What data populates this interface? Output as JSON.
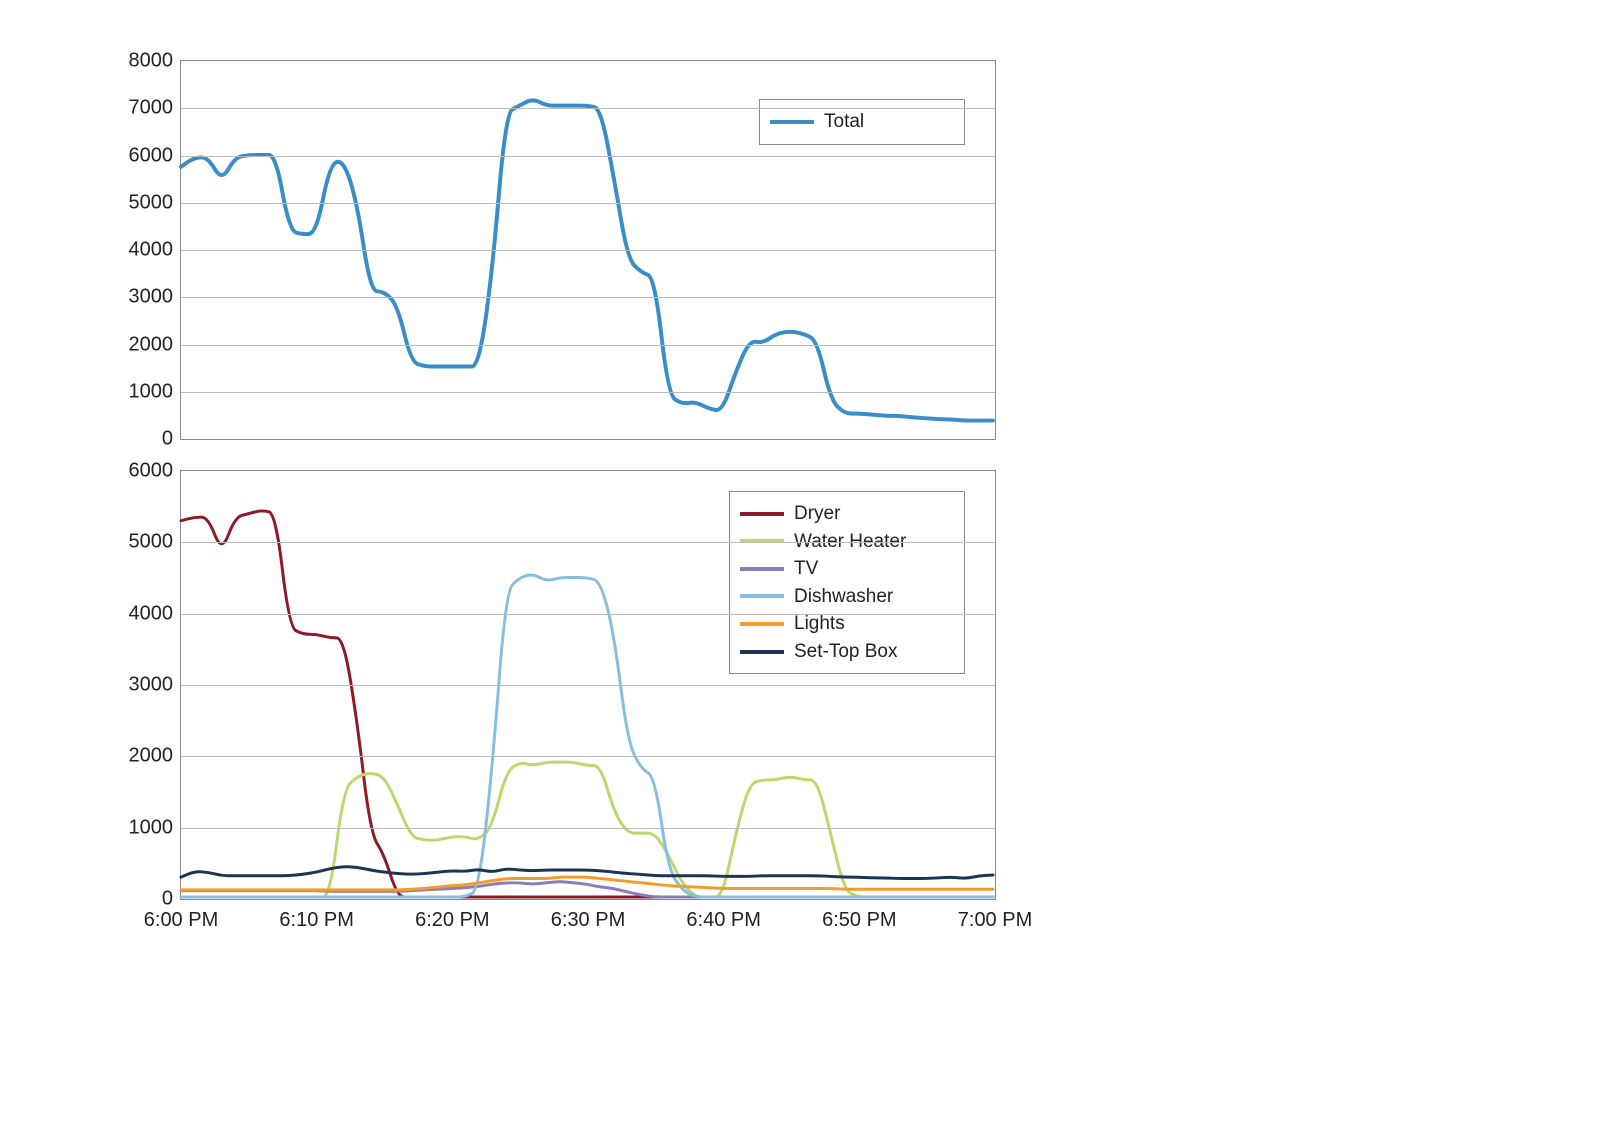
{
  "x_labels": [
    "6:00 PM",
    "6:10 PM",
    "6:20 PM",
    "6:30 PM",
    "6:40 PM",
    "6:50 PM",
    "7:00 PM"
  ],
  "x_range_minutes": [
    0,
    60
  ],
  "chart_top": {
    "ylim": [
      0,
      8000
    ],
    "yticks": [
      0,
      1000,
      2000,
      3000,
      4000,
      5000,
      6000,
      7000,
      8000
    ],
    "legend": [
      {
        "name": "Total",
        "color": "#3a8ec7"
      }
    ]
  },
  "chart_bottom": {
    "ylim": [
      0,
      6000
    ],
    "yticks": [
      0,
      1000,
      2000,
      3000,
      4000,
      5000,
      6000
    ],
    "legend": [
      {
        "name": "Dryer",
        "color": "#8b1a2a"
      },
      {
        "name": "Water Heater",
        "color": "#b9d96a"
      },
      {
        "name": "TV",
        "color": "#8a7eb8"
      },
      {
        "name": "Dishwasher",
        "color": "#87bde0"
      },
      {
        "name": "Lights",
        "color": "#f39c2c"
      },
      {
        "name": "Set-Top Box",
        "color": "#1c3552"
      }
    ]
  },
  "chart_data": [
    {
      "type": "line",
      "title": "",
      "xlabel": "",
      "ylabel": "",
      "x_unit": "minutes after 6:00 PM",
      "ylim": [
        0,
        8000
      ],
      "x_tick_labels": [
        "6:00 PM",
        "6:10 PM",
        "6:20 PM",
        "6:30 PM",
        "6:40 PM",
        "6:50 PM",
        "7:00 PM"
      ],
      "series": [
        {
          "name": "Total",
          "color": "#3a8ec7",
          "stroke_width": 4,
          "x": [
            0,
            1,
            2,
            3,
            4,
            5,
            6,
            7,
            8,
            9,
            10,
            11,
            12,
            13,
            14,
            15,
            16,
            17,
            18,
            19,
            20,
            21,
            22,
            23,
            24,
            25,
            26,
            27,
            28,
            29,
            30,
            31,
            32,
            33,
            34,
            35,
            36,
            37,
            38,
            39,
            40,
            41,
            42,
            43,
            44,
            45,
            46,
            47,
            48,
            49,
            50,
            51,
            52,
            53,
            54,
            55,
            56,
            57,
            58,
            59,
            60
          ],
          "values": [
            5750,
            5950,
            5950,
            5450,
            5950,
            6000,
            6000,
            6000,
            4400,
            4300,
            4350,
            5800,
            5900,
            5000,
            3100,
            3100,
            2800,
            1600,
            1500,
            1500,
            1500,
            1500,
            1500,
            3500,
            6900,
            7050,
            7200,
            7050,
            7050,
            7050,
            7050,
            7000,
            5500,
            3800,
            3500,
            3400,
            900,
            700,
            750,
            600,
            550,
            1400,
            2050,
            2000,
            2200,
            2250,
            2200,
            2050,
            800,
            500,
            500,
            480,
            450,
            450,
            420,
            400,
            380,
            370,
            350,
            350,
            350
          ]
        }
      ]
    },
    {
      "type": "line",
      "title": "",
      "xlabel": "",
      "ylabel": "",
      "x_unit": "minutes after 6:00 PM",
      "ylim": [
        0,
        6000
      ],
      "x_tick_labels": [
        "6:00 PM",
        "6:10 PM",
        "6:20 PM",
        "6:30 PM",
        "6:40 PM",
        "6:50 PM",
        "7:00 PM"
      ],
      "series": [
        {
          "name": "Dryer",
          "color": "#8b1a2a",
          "stroke_width": 3,
          "x": [
            0,
            1,
            2,
            3,
            4,
            5,
            6,
            7,
            8,
            9,
            10,
            11,
            12,
            13,
            14,
            15,
            16,
            17,
            18,
            19,
            20,
            21,
            22,
            23,
            24,
            25,
            26,
            27,
            28,
            29,
            30,
            31,
            32,
            33,
            34,
            35,
            36,
            37,
            38,
            39,
            40,
            41,
            42,
            43,
            44,
            45,
            46,
            47,
            48,
            49,
            50,
            51,
            52,
            53,
            54,
            55,
            56,
            57,
            58,
            59,
            60
          ],
          "values": [
            5300,
            5350,
            5350,
            4850,
            5350,
            5400,
            5450,
            5400,
            3800,
            3700,
            3700,
            3650,
            3650,
            2500,
            900,
            600,
            0,
            0,
            0,
            0,
            0,
            0,
            0,
            0,
            0,
            0,
            0,
            0,
            0,
            0,
            0,
            0,
            0,
            0,
            0,
            0,
            0,
            0,
            0,
            0,
            0,
            0,
            0,
            0,
            0,
            0,
            0,
            0,
            0,
            0,
            0,
            0,
            0,
            0,
            0,
            0,
            0,
            0,
            0,
            0,
            0
          ]
        },
        {
          "name": "Water Heater",
          "color": "#b9d96a",
          "stroke_width": 3,
          "x": [
            0,
            1,
            2,
            3,
            4,
            5,
            6,
            7,
            8,
            9,
            10,
            11,
            12,
            13,
            14,
            15,
            16,
            17,
            18,
            19,
            20,
            21,
            22,
            23,
            24,
            25,
            26,
            27,
            28,
            29,
            30,
            31,
            32,
            33,
            34,
            35,
            36,
            37,
            38,
            39,
            40,
            41,
            42,
            43,
            44,
            45,
            46,
            47,
            48,
            49,
            50,
            51,
            52,
            53,
            54,
            55,
            56,
            57,
            58,
            59,
            60
          ],
          "values": [
            0,
            0,
            0,
            0,
            0,
            0,
            0,
            0,
            0,
            0,
            0,
            0,
            1500,
            1700,
            1750,
            1700,
            1300,
            850,
            800,
            800,
            850,
            850,
            800,
            1000,
            1750,
            1900,
            1850,
            1900,
            1900,
            1900,
            1850,
            1850,
            1200,
            900,
            900,
            900,
            600,
            200,
            0,
            0,
            0,
            900,
            1600,
            1650,
            1650,
            1700,
            1650,
            1650,
            900,
            100,
            0,
            0,
            0,
            0,
            0,
            0,
            0,
            0,
            0,
            0,
            0
          ]
        },
        {
          "name": "TV",
          "color": "#8a7eb8",
          "stroke_width": 3,
          "x": [
            0,
            1,
            2,
            3,
            4,
            5,
            6,
            7,
            8,
            9,
            10,
            11,
            12,
            13,
            14,
            15,
            16,
            17,
            18,
            19,
            20,
            21,
            22,
            23,
            24,
            25,
            26,
            27,
            28,
            29,
            30,
            31,
            32,
            33,
            34,
            35,
            36,
            37,
            38,
            39,
            40,
            41,
            42,
            43,
            44,
            45,
            46,
            47,
            48,
            49,
            50,
            51,
            52,
            53,
            54,
            55,
            56,
            57,
            58,
            59,
            60
          ],
          "values": [
            90,
            90,
            90,
            90,
            90,
            90,
            90,
            90,
            90,
            90,
            90,
            80,
            80,
            80,
            80,
            80,
            80,
            90,
            100,
            110,
            120,
            130,
            150,
            180,
            200,
            200,
            180,
            200,
            220,
            200,
            180,
            140,
            120,
            70,
            30,
            0,
            0,
            0,
            0,
            0,
            0,
            0,
            0,
            0,
            0,
            0,
            0,
            0,
            0,
            0,
            0,
            0,
            0,
            0,
            0,
            0,
            0,
            0,
            0,
            0,
            0
          ]
        },
        {
          "name": "Dishwasher",
          "color": "#87bde0",
          "stroke_width": 3,
          "x": [
            0,
            1,
            2,
            3,
            4,
            5,
            6,
            7,
            8,
            9,
            10,
            11,
            12,
            13,
            14,
            15,
            16,
            17,
            18,
            19,
            20,
            21,
            22,
            23,
            24,
            25,
            26,
            27,
            28,
            29,
            30,
            31,
            32,
            33,
            34,
            35,
            36,
            37,
            38,
            39,
            40,
            41,
            42,
            43,
            44,
            45,
            46,
            47,
            48,
            49,
            50,
            51,
            52,
            53,
            54,
            55,
            56,
            57,
            58,
            59,
            60
          ],
          "values": [
            0,
            0,
            0,
            0,
            0,
            0,
            0,
            0,
            0,
            0,
            0,
            0,
            0,
            0,
            0,
            0,
            0,
            0,
            0,
            0,
            0,
            0,
            100,
            1800,
            4300,
            4500,
            4550,
            4450,
            4500,
            4500,
            4500,
            4450,
            3700,
            2200,
            1800,
            1700,
            400,
            100,
            0,
            0,
            0,
            0,
            0,
            0,
            0,
            0,
            0,
            0,
            0,
            0,
            0,
            0,
            0,
            0,
            0,
            0,
            0,
            0,
            0,
            0,
            0
          ]
        },
        {
          "name": "Lights",
          "color": "#f39c2c",
          "stroke_width": 3,
          "x": [
            0,
            1,
            2,
            3,
            4,
            5,
            6,
            7,
            8,
            9,
            10,
            11,
            12,
            13,
            14,
            15,
            16,
            17,
            18,
            19,
            20,
            21,
            22,
            23,
            24,
            25,
            26,
            27,
            28,
            29,
            30,
            31,
            32,
            33,
            34,
            35,
            36,
            37,
            38,
            39,
            40,
            41,
            42,
            43,
            44,
            45,
            46,
            47,
            48,
            49,
            50,
            51,
            52,
            53,
            54,
            55,
            56,
            57,
            58,
            59,
            60
          ],
          "values": [
            100,
            100,
            100,
            100,
            100,
            100,
            100,
            100,
            100,
            100,
            100,
            100,
            100,
            100,
            100,
            100,
            100,
            110,
            120,
            140,
            160,
            170,
            200,
            230,
            260,
            260,
            260,
            260,
            280,
            280,
            280,
            260,
            240,
            220,
            200,
            180,
            160,
            150,
            140,
            130,
            120,
            120,
            120,
            120,
            120,
            120,
            120,
            120,
            120,
            110,
            110,
            110,
            110,
            110,
            110,
            110,
            110,
            110,
            110,
            110,
            110
          ]
        },
        {
          "name": "Set-Top Box",
          "color": "#1c3552",
          "stroke_width": 3,
          "x": [
            0,
            1,
            2,
            3,
            4,
            5,
            6,
            7,
            8,
            9,
            10,
            11,
            12,
            13,
            14,
            15,
            16,
            17,
            18,
            19,
            20,
            21,
            22,
            23,
            24,
            25,
            26,
            27,
            28,
            29,
            30,
            31,
            32,
            33,
            34,
            35,
            36,
            37,
            38,
            39,
            40,
            41,
            42,
            43,
            44,
            45,
            46,
            47,
            48,
            49,
            50,
            51,
            52,
            53,
            54,
            55,
            56,
            57,
            58,
            59,
            60
          ],
          "values": [
            280,
            360,
            350,
            300,
            300,
            300,
            300,
            300,
            300,
            320,
            350,
            400,
            430,
            420,
            380,
            350,
            330,
            320,
            330,
            350,
            370,
            360,
            390,
            350,
            400,
            380,
            370,
            380,
            380,
            380,
            380,
            370,
            350,
            330,
            320,
            300,
            300,
            300,
            300,
            300,
            290,
            290,
            290,
            300,
            300,
            300,
            300,
            300,
            290,
            280,
            280,
            270,
            270,
            260,
            260,
            260,
            270,
            280,
            260,
            300,
            310
          ]
        }
      ]
    }
  ]
}
